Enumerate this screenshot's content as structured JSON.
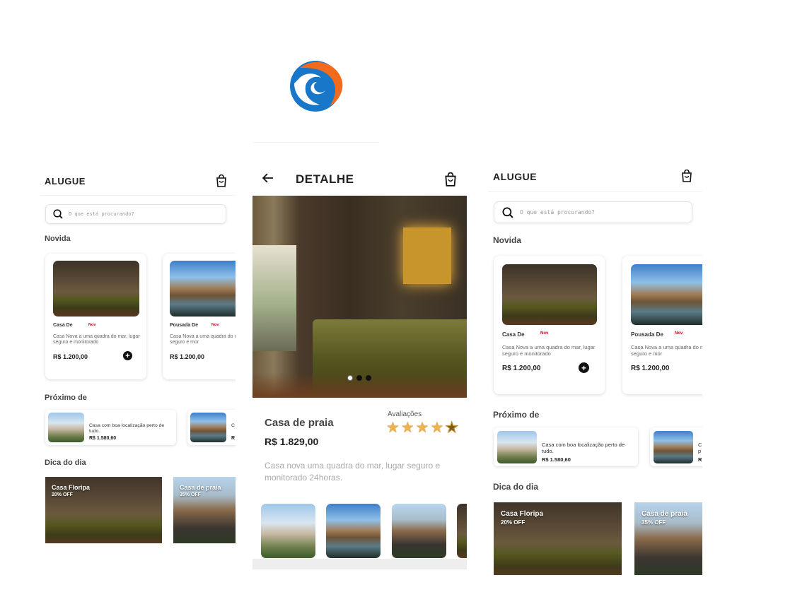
{
  "left": {
    "title": "ALUGUE",
    "search_placeholder": "O que está procurando?",
    "section_new": "Novida",
    "cards": [
      {
        "title": "Casa De",
        "badge": "Nov",
        "desc": "Casa Nova a uma quadra do mar, lugar seguro e monitorado",
        "price": "R$ 1.200,00"
      },
      {
        "title": "Pousada De",
        "badge": "Nov",
        "desc": "Casa Nova a uma quadra do mar, lugar seguro e mor",
        "price": "R$ 1.200,00"
      }
    ],
    "section_near": "Próximo de",
    "near": [
      {
        "desc": "Casa com boa localização perto de tudo.",
        "price": "R$ 1.580,60"
      },
      {
        "desc": "C",
        "price": "R"
      }
    ],
    "section_tip": "Dica do dia",
    "tips": [
      {
        "title": "Casa Floripa",
        "off": "20% OFF"
      },
      {
        "title": "Casa de praia",
        "off": "35% OFF"
      }
    ]
  },
  "detail": {
    "title": "DETALHE",
    "name": "Casa de praia",
    "price": "R$ 1.829,00",
    "ratings_label": "Avaliações",
    "rating": 4.5,
    "desc": "Casa nova uma quadra do mar, lugar seguro e monitorado 24horas."
  },
  "right": {
    "title": "ALUGUE",
    "search_placeholder": "O que está procurando?",
    "section_new": "Novida",
    "cards": [
      {
        "title": "Casa De",
        "badge": "Nov",
        "desc": "Casa Nova a uma quadra do mar, lugar seguro e monitorado",
        "price": "R$ 1.200,00"
      },
      {
        "title": "Pousada De",
        "badge": "Nov",
        "desc": "Casa Nova a uma quadra do mar, lugar seguro e mor",
        "price": "R$ 1.200,00"
      }
    ],
    "section_near": "Próximo de",
    "near": [
      {
        "desc": "Casa com boa localização perto de tudo.",
        "price": "R$ 1.580,60"
      },
      {
        "desc": "C\np",
        "price": "R"
      }
    ],
    "section_tip": "Dica do dia",
    "tips": [
      {
        "title": "Casa Floripa",
        "off": "20% OFF"
      },
      {
        "title": "Casa de praia",
        "off": "35% OFF"
      }
    ]
  },
  "colors": {
    "accent_badge": "#d0021b",
    "logo_orange": "#f26a1b",
    "logo_blue": "#1877c9"
  }
}
